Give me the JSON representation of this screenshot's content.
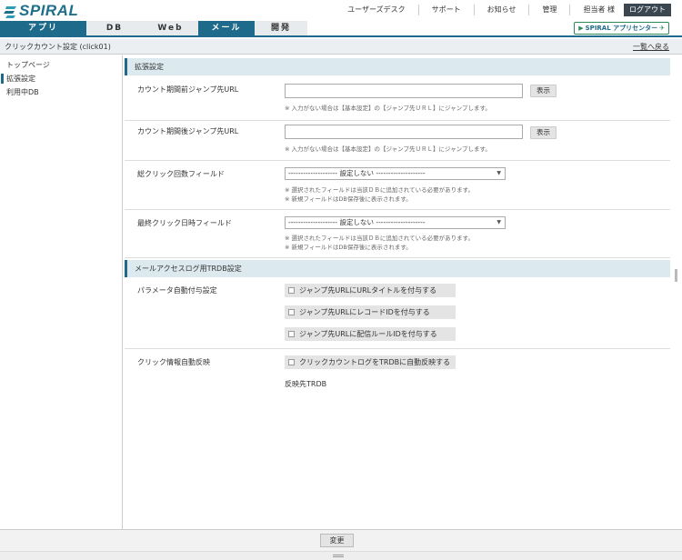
{
  "header": {
    "logo": "SPIRAL",
    "nav": [
      "ユーザーズデスク",
      "サポート",
      "お知らせ",
      "管理"
    ],
    "user": "担当者 様",
    "logout": "ログアウト"
  },
  "tabs": [
    {
      "label": "アプリ"
    },
    {
      "label": "DB"
    },
    {
      "label": "Web"
    },
    {
      "label": "メール"
    },
    {
      "label": "開発"
    }
  ],
  "appcenter": "SPIRAL アプリセンター",
  "breadcrumb": {
    "title": "クリックカウント設定  (click01)",
    "back": "一覧へ戻る"
  },
  "sidebar": {
    "items": [
      {
        "label": "トップページ"
      },
      {
        "label": "拡張設定"
      },
      {
        "label": "利用中DB"
      }
    ]
  },
  "ext": {
    "heading": "拡張設定",
    "before_url": {
      "label": "カウント期間前ジャンプ先URL",
      "value": "",
      "button": "表示",
      "note": "※ 入力がない場合は【基本設定】の【ジャンプ先ＵＲＬ】にジャンプします。"
    },
    "after_url": {
      "label": "カウント期間後ジャンプ先URL",
      "value": "",
      "button": "表示",
      "note": "※ 入力がない場合は【基本設定】の【ジャンプ先ＵＲＬ】にジャンプします。"
    },
    "total_click": {
      "label": "総クリック回数フィールド",
      "selected": "-------------------- 設定しない --------------------",
      "note1": "※ 選択されたフィールドは当該ＤＢに追加されている必要があります。",
      "note2": "※ 新規フィールドはDB保存後に表示されます。"
    },
    "last_click": {
      "label": "最終クリック日時フィールド",
      "selected": "-------------------- 設定しない --------------------",
      "note1": "※ 選択されたフィールドは当該ＤＢに追加されている必要があります。",
      "note2": "※ 新規フィールドはDB保存後に表示されます。"
    }
  },
  "trdb": {
    "heading": "メールアクセスログ用TRDB設定",
    "param": {
      "label": "パラメータ自動付与設定",
      "options": [
        "ジャンプ先URLにURLタイトルを付与する",
        "ジャンプ先URLにレコードIDを付与する",
        "ジャンプ先URLに配信ルールIDを付与する"
      ]
    },
    "click_reflect": {
      "label": "クリック情報自動反映",
      "option": "クリックカウントログをTRDBに自動反映する",
      "target_label": "反映先TRDB"
    }
  },
  "footer": {
    "change": "変更"
  }
}
